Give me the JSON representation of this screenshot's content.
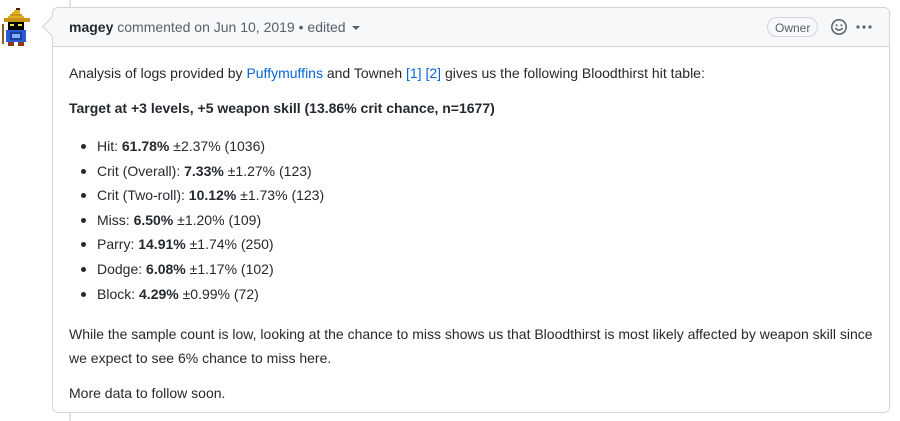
{
  "comment": {
    "author": "magey",
    "action": "commented on",
    "date": "Jun 10, 2019",
    "separator": "•",
    "edited_label": "edited",
    "owner_badge": "Owner"
  },
  "body": {
    "intro_prefix": "Analysis of logs provided by",
    "intro_link_puffymuffins": "Puffymuffins",
    "intro_and": "and Towneh",
    "intro_ref1": "[1]",
    "intro_ref2": "[2]",
    "intro_suffix": "gives us the following Bloodthirst hit table:",
    "target_heading": "Target at +3 levels, +5 weapon skill (13.86% crit chance, n=1677)",
    "hit_table": [
      {
        "label": "Hit:",
        "value": "61.78%",
        "margin": "±2.37%",
        "count": "(1036)"
      },
      {
        "label": "Crit (Overall):",
        "value": "7.33%",
        "margin": "±1.27%",
        "count": "(123)"
      },
      {
        "label": "Crit (Two-roll):",
        "value": "10.12%",
        "margin": "±1.73%",
        "count": "(123)"
      },
      {
        "label": "Miss:",
        "value": "6.50%",
        "margin": "±1.20%",
        "count": "(109)"
      },
      {
        "label": "Parry:",
        "value": "14.91%",
        "margin": "±1.74%",
        "count": "(250)"
      },
      {
        "label": "Dodge:",
        "value": "6.08%",
        "margin": "±1.17%",
        "count": "(102)"
      },
      {
        "label": "Block:",
        "value": "4.29%",
        "margin": "±0.99%",
        "count": "(72)"
      }
    ],
    "conclusion": "While the sample count is low, looking at the chance to miss shows us that Bloodthirst is most likely affected by weapon skill since we expect to see 6% chance to miss here.",
    "more": "More data to follow soon."
  },
  "icons": {
    "avatar": "black-mage-pixel-avatar",
    "reaction": "smiley-icon",
    "menu": "kebab-horizontal-icon",
    "edited_caret": "triangle-down-icon"
  },
  "colors": {
    "link": "#0366d6",
    "header_bg": "#f6f8fa",
    "border": "#d1d5da",
    "text": "#24292e",
    "muted": "#586069"
  }
}
